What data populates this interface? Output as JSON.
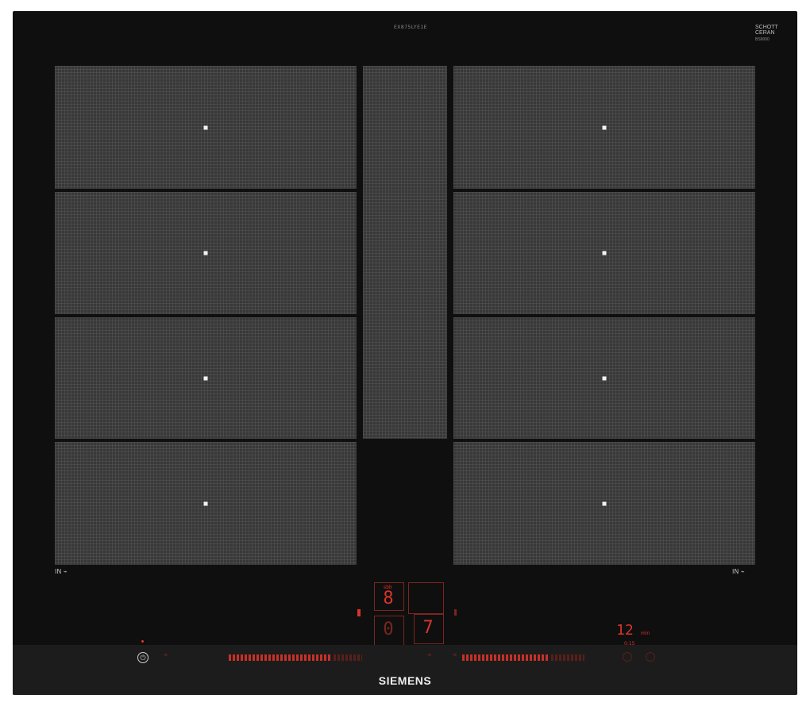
{
  "product": {
    "top_model_text": "EX875LYE1E",
    "glass_brand_line1": "SCHOTT",
    "glass_brand_line2": "CERAN",
    "glass_brand_sub": "BS9000",
    "brand": "SIEMENS",
    "zone_marker_left": "IN ⌁",
    "zone_marker_right": "IN ⌁"
  },
  "controls": {
    "power_symbol": "⏻",
    "top_small_label": "sbb",
    "display_left_top": "8",
    "display_left_bottom": "0",
    "display_right_bottom": "7",
    "timer_value": "12",
    "timer_unit": "min",
    "timer_sub": "0:15",
    "left_minus_symbol": "«",
    "right_minus_symbol": "«",
    "center_minus_symbol": "«"
  },
  "colors": {
    "glass": "#0f0f0f",
    "zone": "#383838",
    "led_red": "#d9342b"
  }
}
